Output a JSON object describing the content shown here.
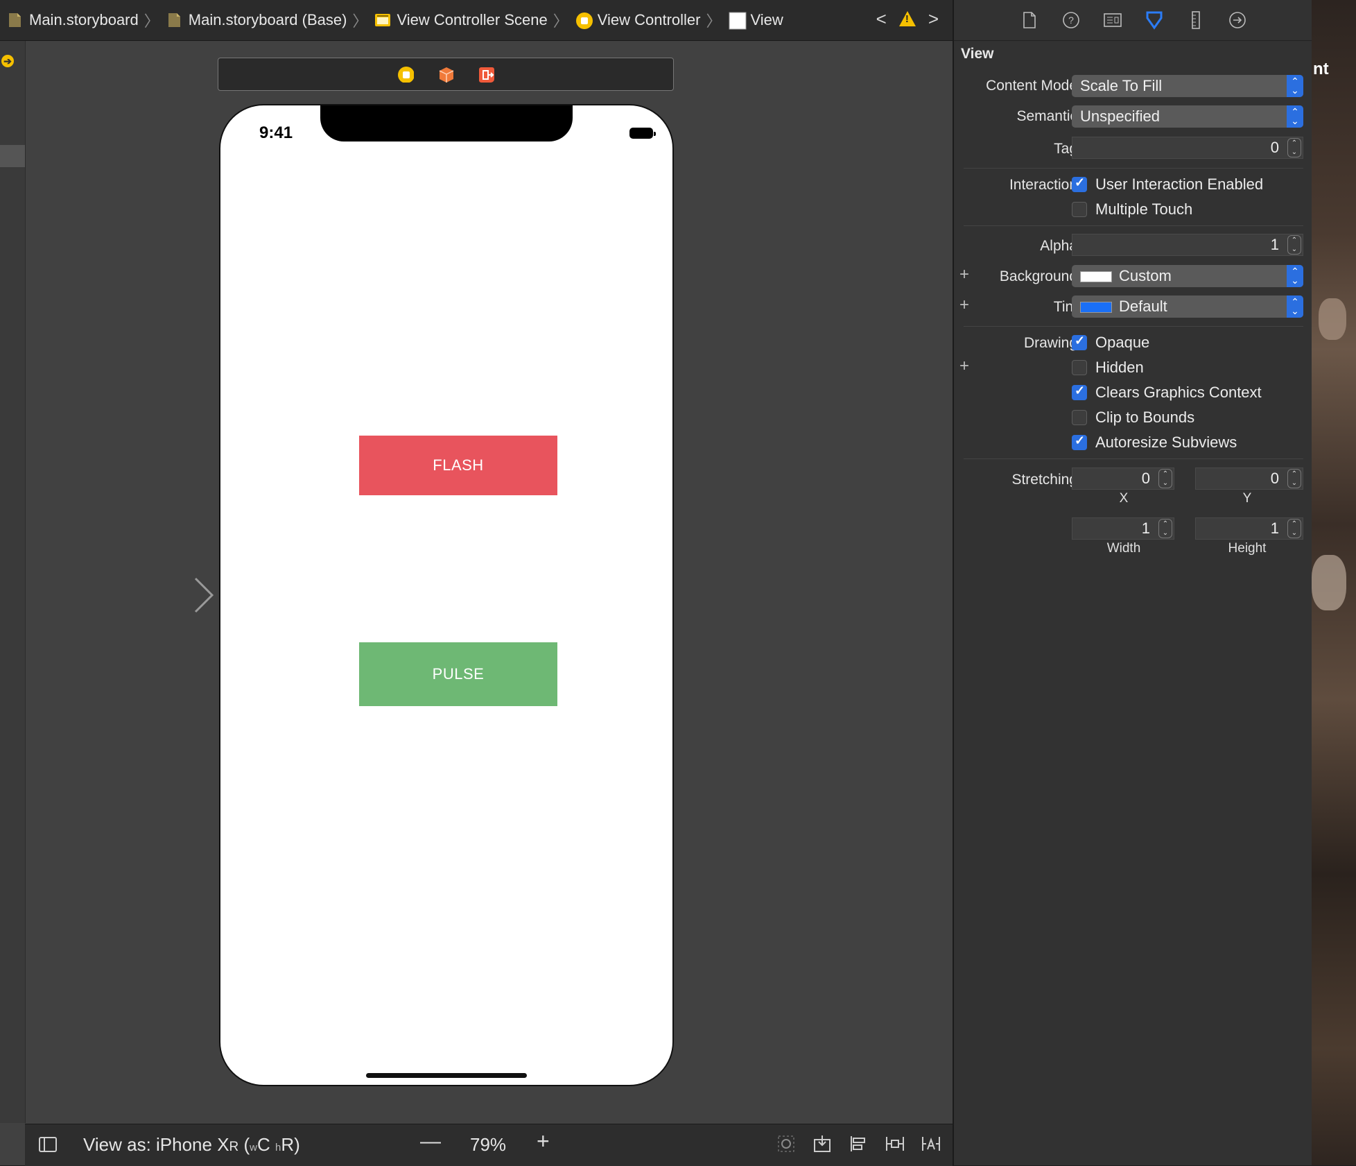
{
  "breadcrumbs": [
    {
      "label": "Main.storyboard",
      "icon": "storyboard-file-icon"
    },
    {
      "label": "Main.storyboard (Base)",
      "icon": "storyboard-file-icon"
    },
    {
      "label": "View Controller Scene",
      "icon": "scene-icon"
    },
    {
      "label": "View Controller",
      "icon": "view-controller-icon"
    },
    {
      "label": "View",
      "icon": "view-icon"
    }
  ],
  "phone": {
    "time": "9:41",
    "flash_label": "FLASH",
    "pulse_label": "PULSE",
    "flash_color": "#e8545d",
    "pulse_color": "#6eb874"
  },
  "bottombar": {
    "view_as_prefix": "View as: iPhone X",
    "view_as_model_suffix": "R",
    "size_class_w": "w",
    "size_class_c": "C",
    "size_class_h": "h",
    "size_class_r": "R",
    "zoom_out": "—",
    "zoom": "79%",
    "zoom_in": "+"
  },
  "inspector": {
    "title": "View",
    "content_mode_label": "Content Mode",
    "content_mode": "Scale To Fill",
    "semantic_label": "Semantic",
    "semantic": "Unspecified",
    "tag_label": "Tag",
    "tag": "0",
    "interaction_label": "Interaction",
    "user_interaction_label": "User Interaction Enabled",
    "multiple_touch_label": "Multiple Touch",
    "alpha_label": "Alpha",
    "alpha": "1",
    "background_label": "Background",
    "background": "Custom",
    "background_color": "#ffffff",
    "tint_label": "Tint",
    "tint": "Default",
    "tint_color": "#1a6ff5",
    "drawing_label": "Drawing",
    "opaque_label": "Opaque",
    "hidden_label": "Hidden",
    "clears_label": "Clears Graphics Context",
    "clip_label": "Clip to Bounds",
    "autoresize_label": "Autoresize Subviews",
    "stretching_label": "Stretching",
    "stretch_x": "0",
    "stretch_y": "0",
    "stretch_x_label": "X",
    "stretch_y_label": "Y",
    "stretch_w": "1",
    "stretch_h": "1",
    "stretch_w_label": "Width",
    "stretch_h_label": "Height",
    "accent_color": "#2b6fe0"
  },
  "desktop": {
    "partial_text": "nt"
  }
}
